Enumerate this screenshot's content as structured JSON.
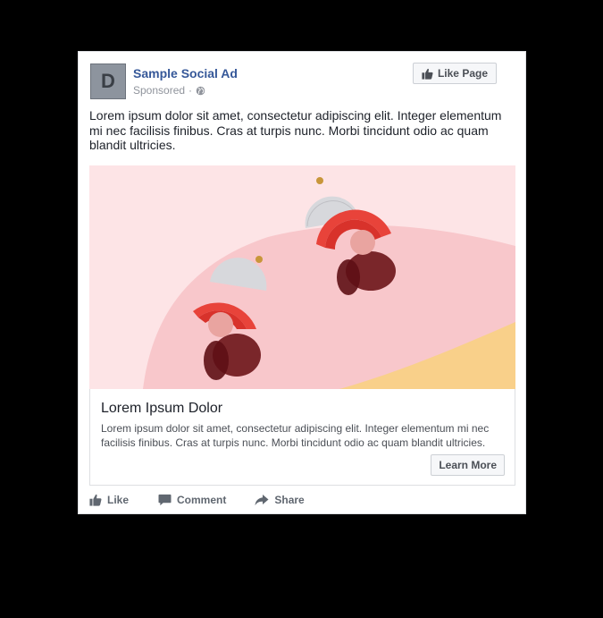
{
  "post": {
    "page_avatar_letter": "D",
    "page_name": "Sample Social Ad",
    "sponsored_label": "Sponsored",
    "separator": "·",
    "like_page_label": "Like Page",
    "text": "Lorem ipsum dolor sit amet, consectetur adipiscing elit. Integer elementum mi nec facilisis finibus. Cras at turpis nunc. Morbi tincidunt odio ac quam blandit ultricies."
  },
  "media": {
    "description_icon": "earrings-photo",
    "background_color": "#fde2e4",
    "accent_color": "#e8433a"
  },
  "link": {
    "title": "Lorem Ipsum Dolor",
    "description": "Lorem ipsum dolor sit amet, consectetur adipiscing elit. Integer elementum mi nec facilisis finibus. Cras at turpis nunc. Morbi tincidunt odio ac quam blandit ultricies.",
    "cta_label": "Learn More"
  },
  "actions": [
    {
      "label": "Like",
      "icon": "thumbs-up-icon"
    },
    {
      "label": "Comment",
      "icon": "comment-icon"
    },
    {
      "label": "Share",
      "icon": "share-icon"
    }
  ],
  "colors": {
    "page_background": "#000000",
    "link_blue": "#365899",
    "secondary_text": "#90949c"
  }
}
